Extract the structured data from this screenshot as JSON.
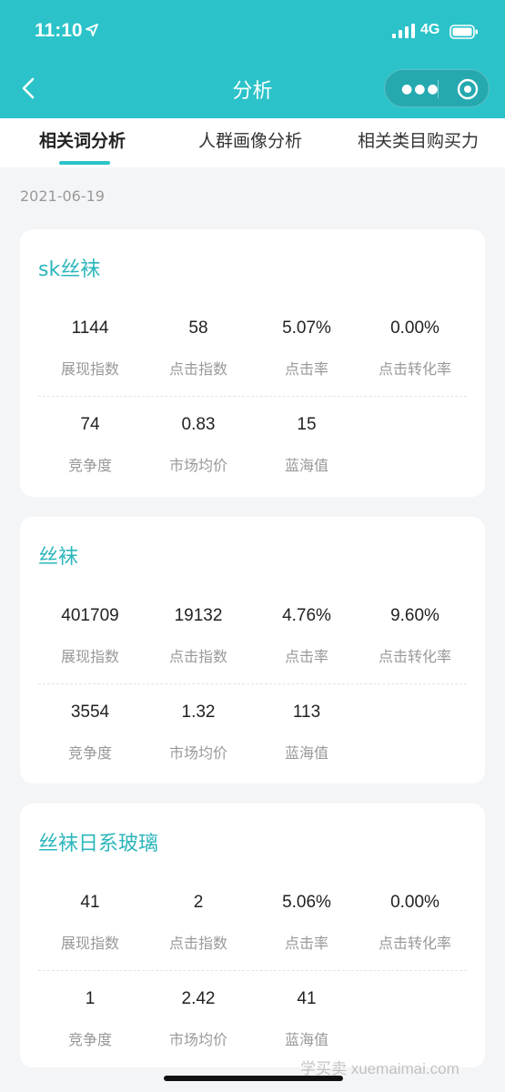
{
  "status": {
    "time": "11:10",
    "network": "4G"
  },
  "nav": {
    "title": "分析"
  },
  "tabs": [
    {
      "label": "相关词分析",
      "active": true
    },
    {
      "label": "人群画像分析",
      "active": false
    },
    {
      "label": "相关类目购买力",
      "active": false
    }
  ],
  "date": "2021-06-19",
  "accent_color": "#2bc3c9",
  "cards": [
    {
      "title": "sk丝袜",
      "metrics": [
        {
          "value": "1144",
          "label": "展现指数"
        },
        {
          "value": "58",
          "label": "点击指数"
        },
        {
          "value": "5.07%",
          "label": "点击率"
        },
        {
          "value": "0.00%",
          "label": "点击转化率"
        },
        {
          "value": "74",
          "label": "竞争度"
        },
        {
          "value": "0.83",
          "label": "市场均价"
        },
        {
          "value": "15",
          "label": "蓝海值"
        }
      ]
    },
    {
      "title": "丝袜",
      "metrics": [
        {
          "value": "401709",
          "label": "展现指数"
        },
        {
          "value": "19132",
          "label": "点击指数"
        },
        {
          "value": "4.76%",
          "label": "点击率"
        },
        {
          "value": "9.60%",
          "label": "点击转化率"
        },
        {
          "value": "3554",
          "label": "竞争度"
        },
        {
          "value": "1.32",
          "label": "市场均价"
        },
        {
          "value": "113",
          "label": "蓝海值"
        }
      ]
    },
    {
      "title": "丝袜日系玻璃",
      "metrics": [
        {
          "value": "41",
          "label": "展现指数"
        },
        {
          "value": "2",
          "label": "点击指数"
        },
        {
          "value": "5.06%",
          "label": "点击率"
        },
        {
          "value": "0.00%",
          "label": "点击转化率"
        },
        {
          "value": "1",
          "label": "竞争度"
        },
        {
          "value": "2.42",
          "label": "市场均价"
        },
        {
          "value": "41",
          "label": "蓝海值"
        }
      ]
    }
  ],
  "watermark": "学买卖 xuemaimai.com"
}
